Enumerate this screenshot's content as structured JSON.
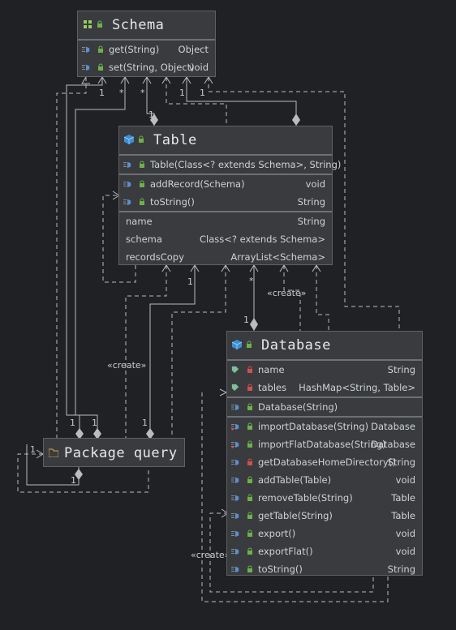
{
  "schema": {
    "title": "Schema",
    "methods": [
      {
        "name": "get(String)",
        "type": "Object"
      },
      {
        "name": "set(String, Object)",
        "type": "void"
      }
    ]
  },
  "table": {
    "title": "Table",
    "constructor": {
      "name": "Table(Class<? extends Schema>, String)"
    },
    "methods": [
      {
        "name": "addRecord(Schema)",
        "type": "void"
      },
      {
        "name": "toString()",
        "type": "String"
      }
    ],
    "fields": [
      {
        "name": "name",
        "type": "String"
      },
      {
        "name": "schema",
        "type": "Class<? extends Schema>"
      },
      {
        "name": "recordsCopy",
        "type": "ArrayList<Schema>"
      }
    ]
  },
  "database": {
    "title": "Database",
    "fields": [
      {
        "name": "name",
        "type": "String"
      },
      {
        "name": "tables",
        "type": "HashMap<String, Table>"
      }
    ],
    "constructor": {
      "name": "Database(String)"
    },
    "methods": [
      {
        "name": "importDatabase(String)",
        "type": "Database"
      },
      {
        "name": "importFlatDatabase(String)",
        "type": "Database"
      },
      {
        "name": "getDatabaseHomeDirectory()",
        "type": "String"
      },
      {
        "name": "addTable(Table)",
        "type": "void"
      },
      {
        "name": "removeTable(String)",
        "type": "Table"
      },
      {
        "name": "getTable(String)",
        "type": "Table"
      },
      {
        "name": "export()",
        "type": "void"
      },
      {
        "name": "exportFlat()",
        "type": "void"
      },
      {
        "name": "toString()",
        "type": "String"
      }
    ]
  },
  "package": {
    "title": "Package query"
  },
  "labels": {
    "create_table": "«create»",
    "create_database": "«create»",
    "create_self": "«create»",
    "m_one": "1",
    "m_many": "*"
  },
  "colors": {
    "background": "#1f2124",
    "box": "#393b3e",
    "border": "#5e6164",
    "line": "#b9bcc0",
    "class_icon": "#3c8fd6",
    "lock_green": "#6fb04a",
    "lock_red": "#d05050"
  }
}
